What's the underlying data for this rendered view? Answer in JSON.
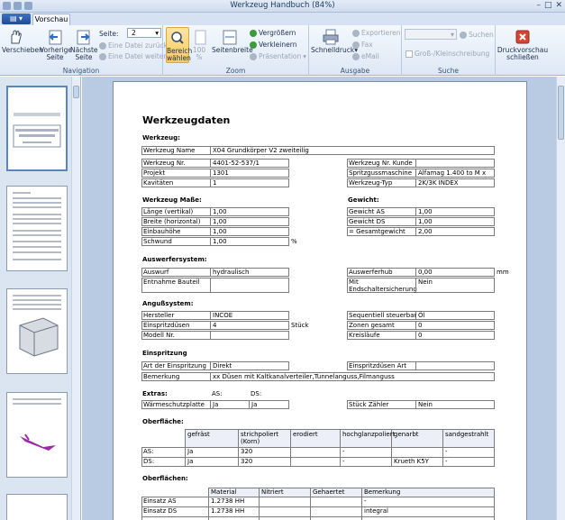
{
  "window": {
    "title": "Werkzeug Handbuch (84%)"
  },
  "tabs": {
    "app_menu": "",
    "preview": "Vorschau"
  },
  "navigation": {
    "group": "Navigation",
    "move": "Verschieben",
    "prev_page": "Vorherige Seite",
    "next_page": "Nächste Seite",
    "page_label": "Seite:",
    "page_value": "2",
    "file_back": "Eine Datei zurück",
    "file_forward": "Eine Datei weiter"
  },
  "zoom": {
    "group": "Zoom",
    "select_area": "Bereich wählen",
    "percent": "100 %",
    "page_width": "Seitenbreite",
    "zoom_in": "Vergrößern",
    "zoom_out": "Verkleinern",
    "presentation": "Präsentation"
  },
  "output": {
    "group": "Ausgabe",
    "quick_print": "Schnelldruck",
    "export": "Exportieren",
    "fax": "Fax",
    "email": "eMail"
  },
  "search": {
    "group": "Suche",
    "search": "Suchen",
    "case": "Groß-/Kleinschreibung"
  },
  "close": {
    "label": "Druckvorschau schließen"
  },
  "doc": {
    "title": "Werkzeugdaten",
    "sec_tool": "Werkzeug:",
    "tool_name_l": "Werkzeug Name",
    "tool_name_v": "X04 Grundkörper V2 zweiteilig",
    "tool_nr_l": "Werkzeug Nr.",
    "tool_nr_v": "4401-52-537/1",
    "customer_l": "Werkzeug Nr. Kunde",
    "customer_v": "",
    "project_l": "Projekt",
    "project_v": "1301",
    "machine_l": "Spritzgussmaschine",
    "machine_v": "Alfamag 1.400 to M x",
    "cav_l": "Kavitäten",
    "cav_v": "1",
    "type_l": "Werkzeug-Typ",
    "type_v": "2K/3K INDEX",
    "sec_dims": "Werkzeug Maße:",
    "len_l": "Länge (vertikal)",
    "len_v": "1,00",
    "wid_l": "Breite (horizontal)",
    "wid_v": "1,00",
    "hgt_l": "Einbauhöhe",
    "hgt_v": "1,00",
    "swing_l": "Schwund",
    "swing_v": "1,00",
    "swing_u": "%",
    "sec_weight": "Gewicht:",
    "wAS_l": "Gewicht AS",
    "wAS_v": "1,00",
    "wDS_l": "Gewicht DS",
    "wDS_v": "1,00",
    "wTot_l": "= Gesamtgewicht",
    "wTot_v": "2,00",
    "sec_ejector": "Auswerfersystem:",
    "ej_l": "Auswurf",
    "ej_v": "hydraulisch",
    "ejs_l": "Auswerferhub",
    "ejs_v": "0,00",
    "ejs_u": "mm",
    "rem_l": "Entnahme Bauteil",
    "rem_v": "",
    "endsw_l": "Mit Endschaltersicherung",
    "endsw_v": "Nein",
    "sec_gate": "Angußsystem:",
    "mfr_l": "Hersteller",
    "mfr_v": "INCOE",
    "seq_l": "Sequentiell steuerbar",
    "seq_v": "Öl",
    "noz_l": "Einspritzdüsen",
    "noz_v": "4",
    "noz_u": "Stück",
    "zones_l": "Zonen gesamt",
    "zones_v": "0",
    "model_l": "Modell Nr.",
    "model_v": "",
    "circ_l": "Kreisläufe",
    "circ_v": "0",
    "sec_inj": "Einspritzung",
    "injtype_l": "Art der Einspritzung",
    "injtype_v": "Direkt",
    "injnoz_l": "Einspritzdüsen Art",
    "injnoz_v": "",
    "note_l": "Bemerkung",
    "note_v": "xx Düsen mit Kaltkanalverteiler,Tunnelanguss,Filmanguss",
    "sec_extra": "Extras:",
    "extra_as": "AS:",
    "extra_ds": "DS:",
    "heat_l": "Wärmeschutzplatte",
    "heat_as": "Ja",
    "heat_ds": "Ja",
    "counter_l": "Stück Zähler",
    "counter_v": "Nein",
    "sec_surface": "Oberfläche:",
    "surface_cols": [
      "gefräst",
      "strichpoliert (Korn)",
      "erodiert",
      "hochglanzpoliert",
      "genarbt",
      "sandgestrahlt"
    ],
    "surface_rows": [
      {
        "label": "AS:",
        "cells": [
          "Ja",
          "320",
          "",
          "-",
          "",
          "-"
        ]
      },
      {
        "label": "DS:",
        "cells": [
          "Ja",
          "320",
          "",
          "-",
          "Krueth K5Y",
          "-"
        ]
      }
    ],
    "sec_surfaces": "Oberflächen:",
    "surfaces_cols": [
      "Material",
      "Nitriert",
      "Gehaertet",
      "Bemerkung"
    ],
    "surfaces_rows": [
      {
        "label": "Einsatz AS",
        "cells": [
          "1.2738 HH",
          "",
          "",
          "-"
        ]
      },
      {
        "label": "Einsatz DS",
        "cells": [
          "1.2738 HH",
          "",
          "",
          "integral"
        ]
      }
    ]
  }
}
